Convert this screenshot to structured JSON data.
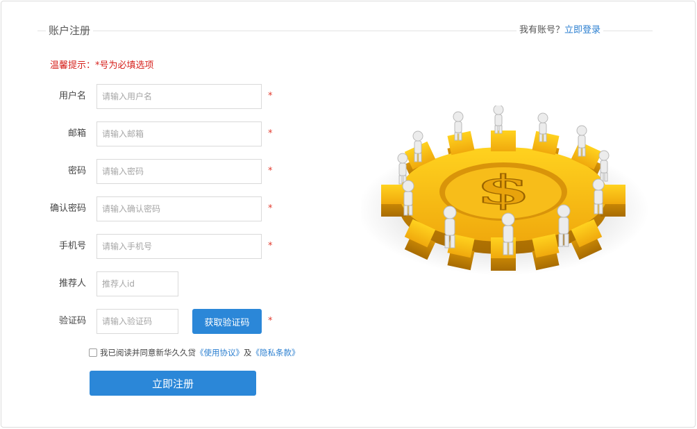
{
  "header": {
    "title": "账户注册",
    "have_account": "我有账号？",
    "login_link": "立即登录"
  },
  "tip": "温馨提示：*号为必填选项",
  "form": {
    "required_mark": "*",
    "fields": [
      {
        "label": "用户名",
        "placeholder": "请输入用户名"
      },
      {
        "label": "邮箱",
        "placeholder": "请输入邮箱"
      },
      {
        "label": "密码",
        "placeholder": "请输入密码"
      },
      {
        "label": "确认密码",
        "placeholder": "请输入确认密码"
      },
      {
        "label": "手机号",
        "placeholder": "请输入手机号"
      },
      {
        "label": "推荐人",
        "placeholder": "推荐人id"
      },
      {
        "label": "验证码",
        "placeholder": "请输入验证码"
      }
    ],
    "get_code_button": "获取验证码",
    "agreement": {
      "text": "我已阅读并同意新华久久贷",
      "terms_link": "《使用协议》",
      "connector": "及",
      "privacy_link": "《隐私条款》",
      "checked": false
    },
    "submit_button": "立即注册"
  },
  "illustration": {
    "icon": "dollar-gear-team-illustration",
    "colors": {
      "gear": "#f4b316",
      "gear_dark": "#c88a05",
      "people": "#e6e6e6"
    }
  },
  "colors": {
    "accent": "#2b87d8",
    "link": "#2b7fd0",
    "warning": "#d6221d",
    "required": "#e23b2e"
  }
}
